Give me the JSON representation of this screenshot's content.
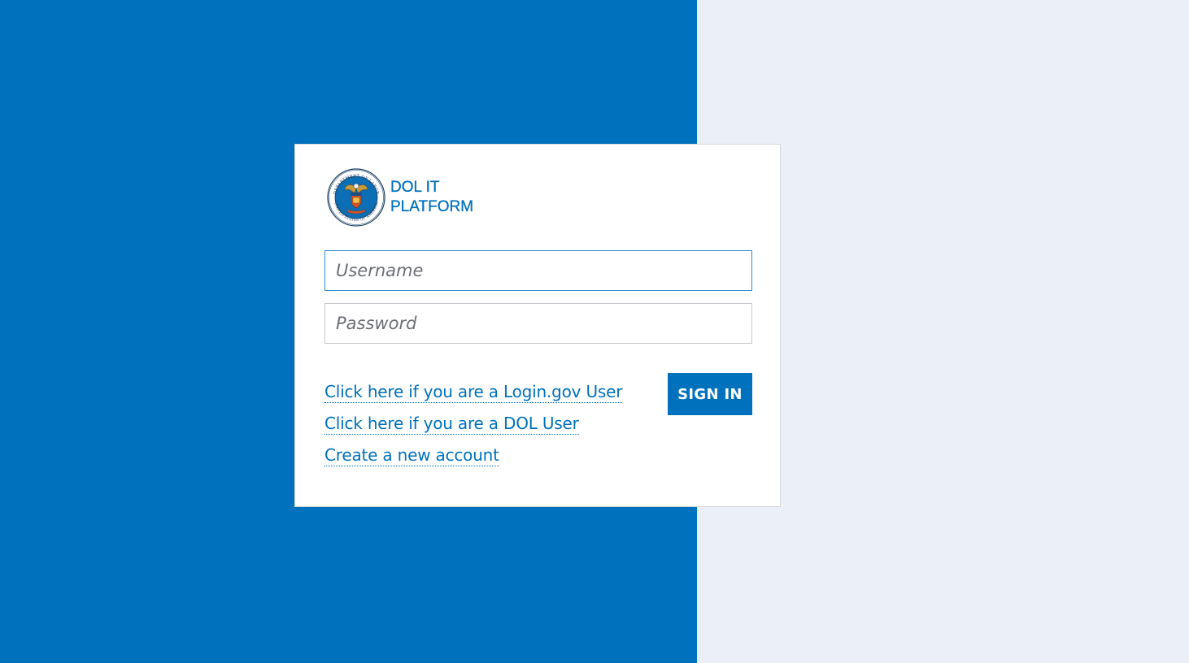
{
  "brand": {
    "line1": "DOL IT",
    "line2": "PLATFORM",
    "seal_icon": "department-of-labor-seal",
    "seal_text_top": "DEPARTMENT OF LABOR",
    "seal_text_bottom": "UNITED STATES OF AMERICA"
  },
  "form": {
    "username_placeholder": "Username",
    "username_value": "",
    "password_placeholder": "Password",
    "password_value": "",
    "signin_label": "SIGN IN"
  },
  "links": {
    "login_gov": "Click here if you are a Login.gov User",
    "dol_user": "Click here if you are a DOL User",
    "create_account": "Create a new account"
  },
  "colors": {
    "primary": "#0071bc",
    "page_right": "#ebeff7",
    "card": "#ffffff"
  }
}
